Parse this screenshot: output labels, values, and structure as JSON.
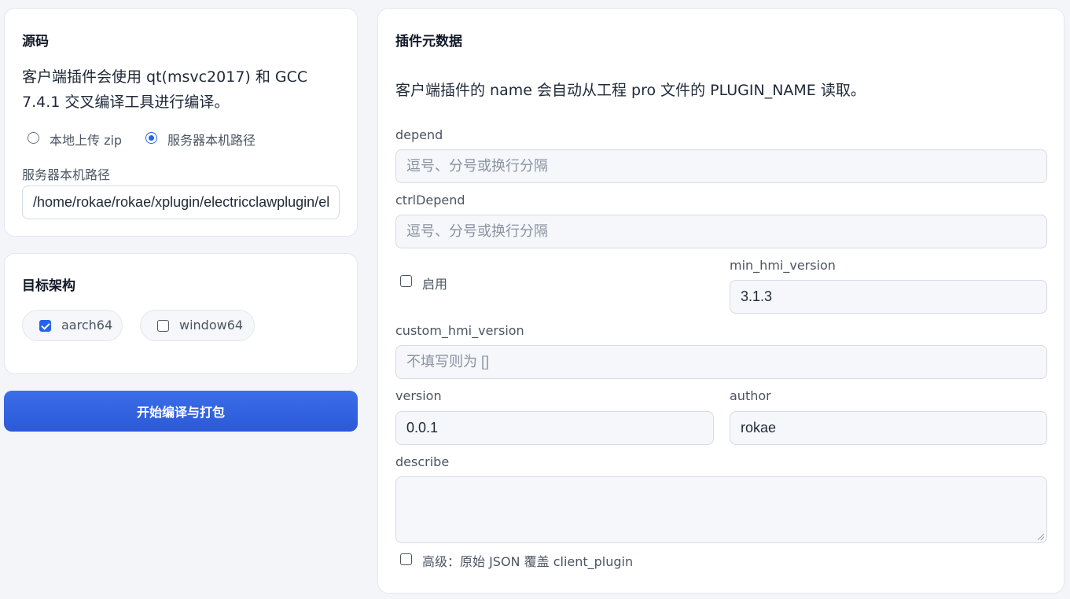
{
  "source": {
    "title": "源码",
    "description": "客户端插件会使用 qt(msvc2017) 和 GCC 7.4.1 交叉编译工具进行编译。",
    "options": [
      {
        "label": "本地上传 zip",
        "checked": false
      },
      {
        "label": "服务器本机路径",
        "checked": true
      }
    ],
    "path_label": "服务器本机路径",
    "path_value": "/home/rokae/rokae/xplugin/electricclawplugin/el"
  },
  "target": {
    "title": "目标架构",
    "archs": [
      {
        "label": "aarch64",
        "checked": true
      },
      {
        "label": "window64",
        "checked": false
      }
    ]
  },
  "build_button": "开始编译与打包",
  "meta": {
    "title": "插件元数据",
    "description": "客户端插件的 name 会自动从工程 pro 文件的 PLUGIN_NAME 读取。",
    "depend": {
      "label": "depend",
      "placeholder": "逗号、分号或换行分隔",
      "value": ""
    },
    "ctrlDepend": {
      "label": "ctrlDepend",
      "placeholder": "逗号、分号或换行分隔",
      "value": ""
    },
    "enable": {
      "label": "启用",
      "checked": false
    },
    "min_hmi_version": {
      "label": "min_hmi_version",
      "value": "3.1.3"
    },
    "custom_hmi_version": {
      "label": "custom_hmi_version",
      "placeholder": "不填写则为 []",
      "value": ""
    },
    "version": {
      "label": "version",
      "value": "0.0.1"
    },
    "author": {
      "label": "author",
      "value": "rokae"
    },
    "describe": {
      "label": "describe",
      "value": ""
    },
    "advanced": {
      "label": "高级：原始 JSON 覆盖 client_plugin",
      "checked": false
    }
  },
  "colors": {
    "accent": "#2563eb",
    "button": "#3066e0"
  }
}
